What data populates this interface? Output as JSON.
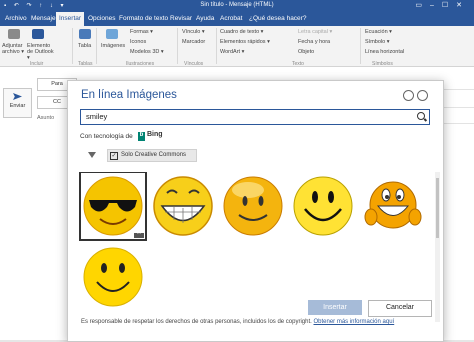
{
  "window": {
    "title": "Sin título - Mensaje (HTML)",
    "window_controls": [
      "▭",
      "–",
      "☐",
      "✕"
    ]
  },
  "ribbon_tabs": [
    "Archivo",
    "Mensaje",
    "Insertar",
    "Opciones",
    "Formato de texto",
    "Revisar",
    "Ayuda",
    "Acrobat",
    "¿Qué desea hacer?"
  ],
  "active_tab": "Insertar",
  "ribbon": {
    "adjuntar": "Adjuntar archivo ▾",
    "elemento": "Elemento de Outlook ▾",
    "tabla": "Tabla",
    "imagenes": "Imágenes",
    "formas": "Formas ▾",
    "iconos": "Iconos",
    "modelos3d": "Modelos 3D ▾",
    "vinculo": "Vínculo ▾",
    "marcador": "Marcador",
    "cuadro": "Cuadro de texto ▾",
    "elementos_rapidos": "Elementos rápidos ▾",
    "wordart": "WordArt ▾",
    "letra_capital": "Letra capital ▾",
    "fecha": "Fecha y hora",
    "objeto": "Objeto",
    "ecuacion": "Ecuación ▾",
    "simbolo": "Símbolo ▾",
    "linea": "Línea horizontal",
    "groups": {
      "incluir": "Incluir",
      "tablas": "Tablas",
      "ilustraciones": "Ilustraciones",
      "vinculos": "Vínculos",
      "texto": "Texto",
      "simbolos": "Símbolos"
    }
  },
  "compose": {
    "send": "Enviar",
    "para": "Para",
    "cc": "CC",
    "asunto": "Asunto"
  },
  "dialog": {
    "title": "En línea Imágenes",
    "search_value": "smiley",
    "powered_by": "Con tecnología de",
    "bing": "Bing",
    "filter_label": "Solo Creative Commons",
    "insert_button": "Insertar",
    "cancel_button": "Cancelar",
    "notice": "Es responsable de respetar los derechos de otras personas, incluidos los de copyright.",
    "notice_link": "Obtener más información aquí",
    "more_label": "···",
    "results": [
      "smiley-sunglasses",
      "smiley-big-grin",
      "smiley-orange-smile",
      "smiley-classic",
      "smiley-laughing-hands",
      "smiley-flat"
    ]
  },
  "colors": {
    "brand": "#2b579a",
    "yellow": "#f5d30b",
    "orange": "#f4a300"
  }
}
